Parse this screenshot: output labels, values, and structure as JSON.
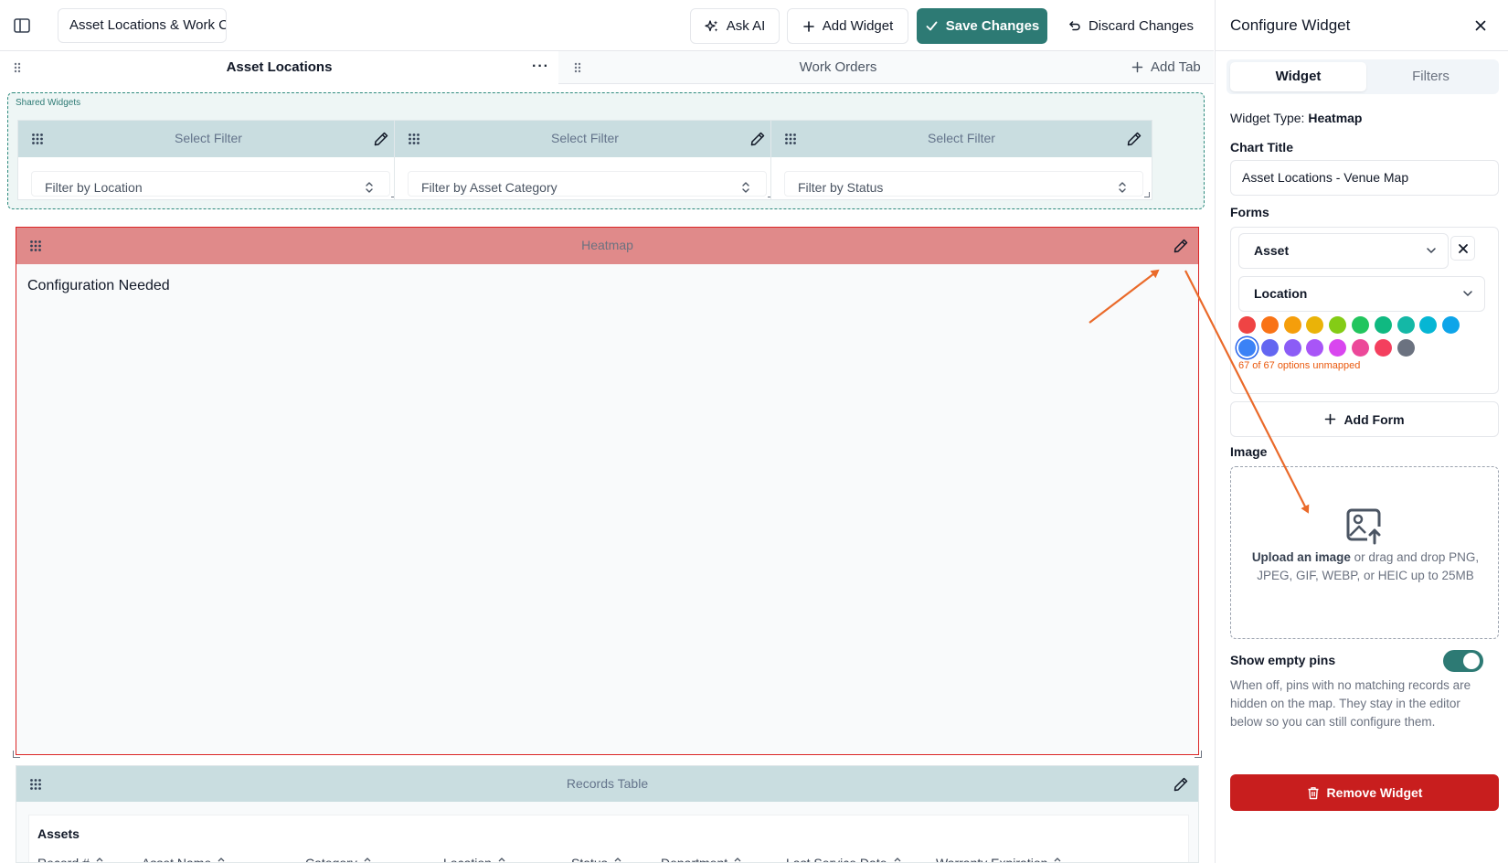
{
  "topbar": {
    "dashboard_name": "Asset Locations & Work C",
    "ask_ai": "Ask AI",
    "add_widget": "Add Widget",
    "save_changes": "Save Changes",
    "discard_changes": "Discard Changes"
  },
  "tabs": {
    "active": "Asset Locations",
    "inactive": "Work Orders",
    "more": "···",
    "add_tab": "Add Tab"
  },
  "shared": {
    "label": "Shared Widgets",
    "filters": [
      {
        "title": "Select Filter",
        "placeholder": "Filter by Location"
      },
      {
        "title": "Select Filter",
        "placeholder": "Filter by Asset Category"
      },
      {
        "title": "Select Filter",
        "placeholder": "Filter by Status"
      }
    ]
  },
  "heatmap": {
    "title": "Heatmap",
    "message": "Configuration Needed"
  },
  "records": {
    "title": "Records Table",
    "subtitle": "Assets",
    "columns": [
      "Record #",
      "Asset Name",
      "Category",
      "Location",
      "Status",
      "Department",
      "Last Service Date",
      "Warranty Expiration"
    ]
  },
  "panel": {
    "title": "Configure Widget",
    "tab_widget": "Widget",
    "tab_filters": "Filters",
    "widget_type_label": "Widget Type:",
    "widget_type_value": "Heatmap",
    "chart_title_label": "Chart Title",
    "chart_title_value": "Asset Locations - Venue Map",
    "forms_label": "Forms",
    "form_select": "Asset",
    "field_select": "Location",
    "swatches": [
      "#ef4444",
      "#f97316",
      "#f59e0b",
      "#eab308",
      "#84cc16",
      "#22c55e",
      "#10b981",
      "#14b8a6",
      "#06b6d4",
      "#0ea5e9",
      "#3b82f6",
      "#6366f1",
      "#8b5cf6",
      "#a855f7",
      "#d946ef",
      "#ec4899",
      "#f43f5e",
      "#6b7280"
    ],
    "selected_swatch_index": 10,
    "unmapped": "67 of 67 options unmapped",
    "add_form": "Add Form",
    "image_label": "Image",
    "upload_link": "Upload an image",
    "upload_rest": " or drag and drop PNG, JPEG, GIF, WEBP, or HEIC up to 25MB",
    "toggle_label": "Show empty pins",
    "toggle_on": true,
    "help_text": "When off, pins with no matching records are hidden on the map. They stay in the editor below so you can still configure them.",
    "remove_widget": "Remove Widget",
    "accent_color": "#2d7a74",
    "danger_color": "#c81e1e"
  }
}
